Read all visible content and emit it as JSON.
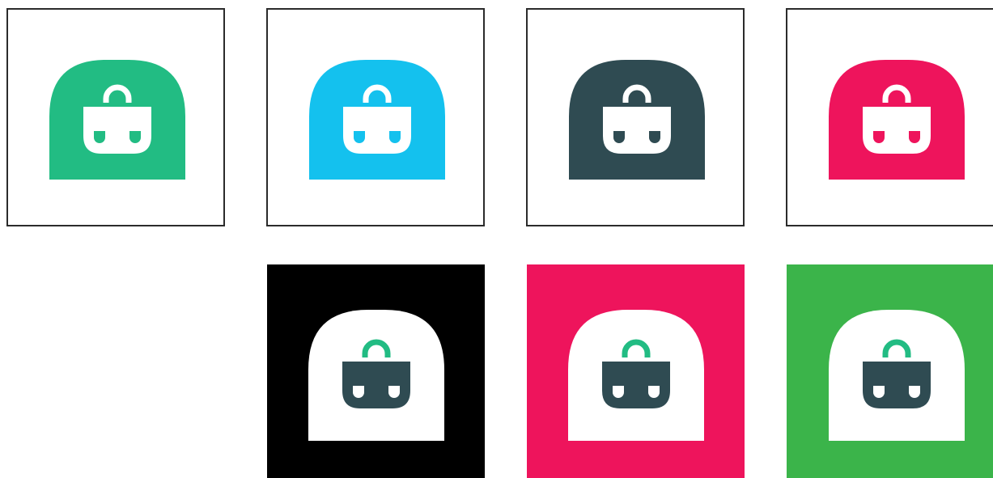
{
  "variants": [
    {
      "background": "#ffffff",
      "border": "#2b2b2b",
      "shape": "#22bc83",
      "handle": "#ffffff",
      "basket": "#ffffff",
      "holes": "#22bc83",
      "icon": "shopping-basket-logo-icon"
    },
    {
      "background": "#ffffff",
      "border": "#2b2b2b",
      "shape": "#14c1ee",
      "handle": "#ffffff",
      "basket": "#ffffff",
      "holes": "#14c1ee",
      "icon": "shopping-basket-logo-icon"
    },
    {
      "background": "#ffffff",
      "border": "#2b2b2b",
      "shape": "#2f4b52",
      "handle": "#ffffff",
      "basket": "#ffffff",
      "holes": "#2f4b52",
      "icon": "shopping-basket-logo-icon"
    },
    {
      "background": "#ffffff",
      "border": "#2b2b2b",
      "shape": "#ee145c",
      "handle": "#ffffff",
      "basket": "#ffffff",
      "holes": "#ee145c",
      "icon": "shopping-basket-logo-icon"
    },
    {
      "background": "#000000",
      "border": "",
      "shape": "#ffffff",
      "handle": "#22bc83",
      "basket": "#2f4b52",
      "holes": "#ffffff",
      "icon": "shopping-basket-logo-icon"
    },
    {
      "background": "#ee145c",
      "border": "",
      "shape": "#ffffff",
      "handle": "#22bc83",
      "basket": "#2f4b52",
      "holes": "#ffffff",
      "icon": "shopping-basket-logo-icon"
    },
    {
      "background": "#3bb44a",
      "border": "",
      "shape": "#ffffff",
      "handle": "#22bc83",
      "basket": "#2f4b52",
      "holes": "#ffffff",
      "icon": "shopping-basket-logo-icon"
    }
  ]
}
